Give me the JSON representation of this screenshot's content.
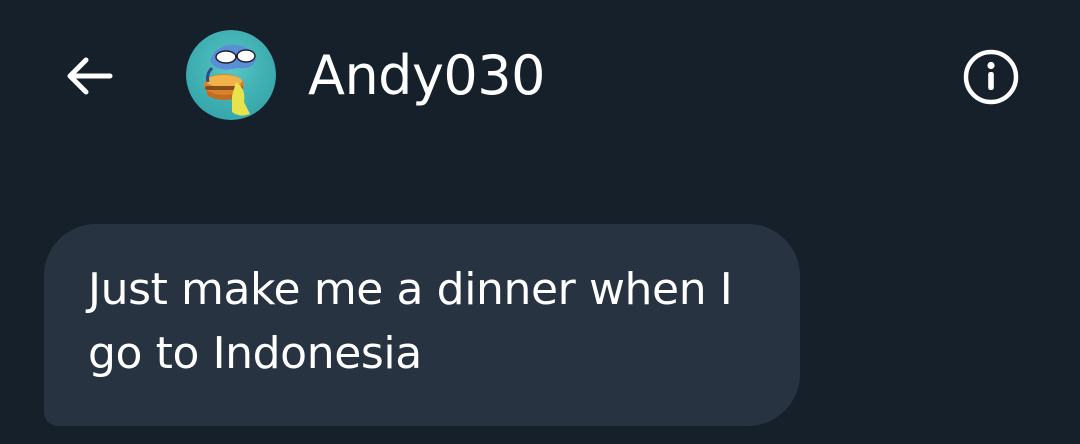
{
  "header": {
    "back_icon": "arrow-left-icon",
    "avatar_icon": "avatar-image",
    "user_name": "Andy030",
    "info_icon": "info-circle-icon"
  },
  "conversation": {
    "messages": [
      {
        "direction": "received",
        "text": "Just make me a dinner when I go to Indonesia"
      }
    ]
  },
  "colors": {
    "background": "#15202b",
    "bubble_received": "#273340",
    "text": "#ffffff",
    "icon": "#ffffff"
  }
}
